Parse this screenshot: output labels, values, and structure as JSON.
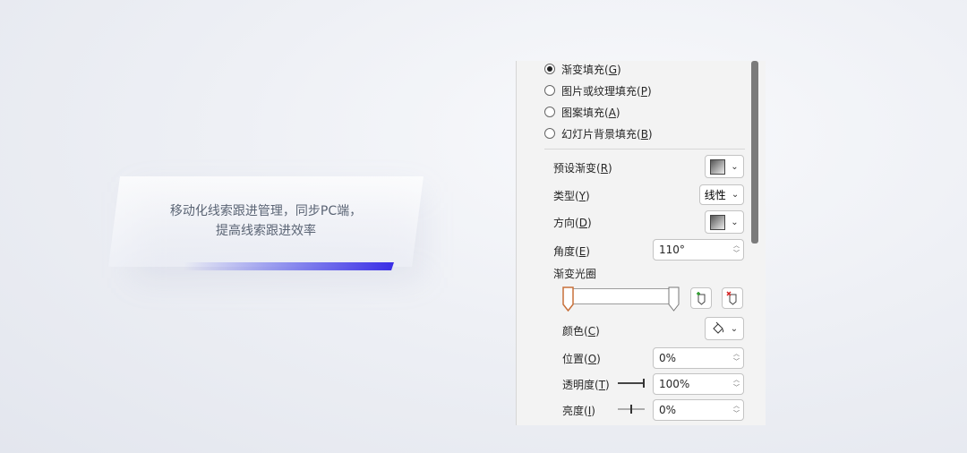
{
  "card": {
    "line1": "移动化线索跟进管理，同步PC端，",
    "line2": "提高线索跟进效率"
  },
  "fill_options": [
    {
      "label": "渐变填充(",
      "key": "G",
      "suffix": ")",
      "checked": true
    },
    {
      "label": "图片或纹理填充(",
      "key": "P",
      "suffix": ")",
      "checked": false
    },
    {
      "label": "图案填充(",
      "key": "A",
      "suffix": ")",
      "checked": false
    },
    {
      "label": "幻灯片背景填充(",
      "key": "B",
      "suffix": ")",
      "checked": false
    }
  ],
  "preset": {
    "label": "预设渐变(",
    "key": "R",
    "suffix": ")"
  },
  "type": {
    "label": "类型(",
    "key": "Y",
    "suffix": ")",
    "value": "线性"
  },
  "direction": {
    "label": "方向(",
    "key": "D",
    "suffix": ")"
  },
  "angle": {
    "label": "角度(",
    "key": "E",
    "suffix": ")",
    "value": "110°"
  },
  "gradient_stops": {
    "label": "渐变光圈"
  },
  "color": {
    "label": "颜色(",
    "key": "C",
    "suffix": ")"
  },
  "position": {
    "label": "位置(",
    "key": "O",
    "suffix": ")",
    "value": "0%"
  },
  "transparency": {
    "label": "透明度(",
    "key": "T",
    "suffix": ")",
    "value": "100%",
    "level": 1.0
  },
  "brightness": {
    "label": "亮度(",
    "key": "I",
    "suffix": ")",
    "value": "0%",
    "level": 0.5
  },
  "icons": {
    "add_stop": "add-gradient-stop-icon",
    "remove_stop": "remove-gradient-stop-icon",
    "paint_bucket": "paint-bucket-icon"
  },
  "colors": {
    "accent": "#3a2ee6",
    "panel_bg": "#f3f3f3",
    "stop_selected": "#c8703a"
  }
}
